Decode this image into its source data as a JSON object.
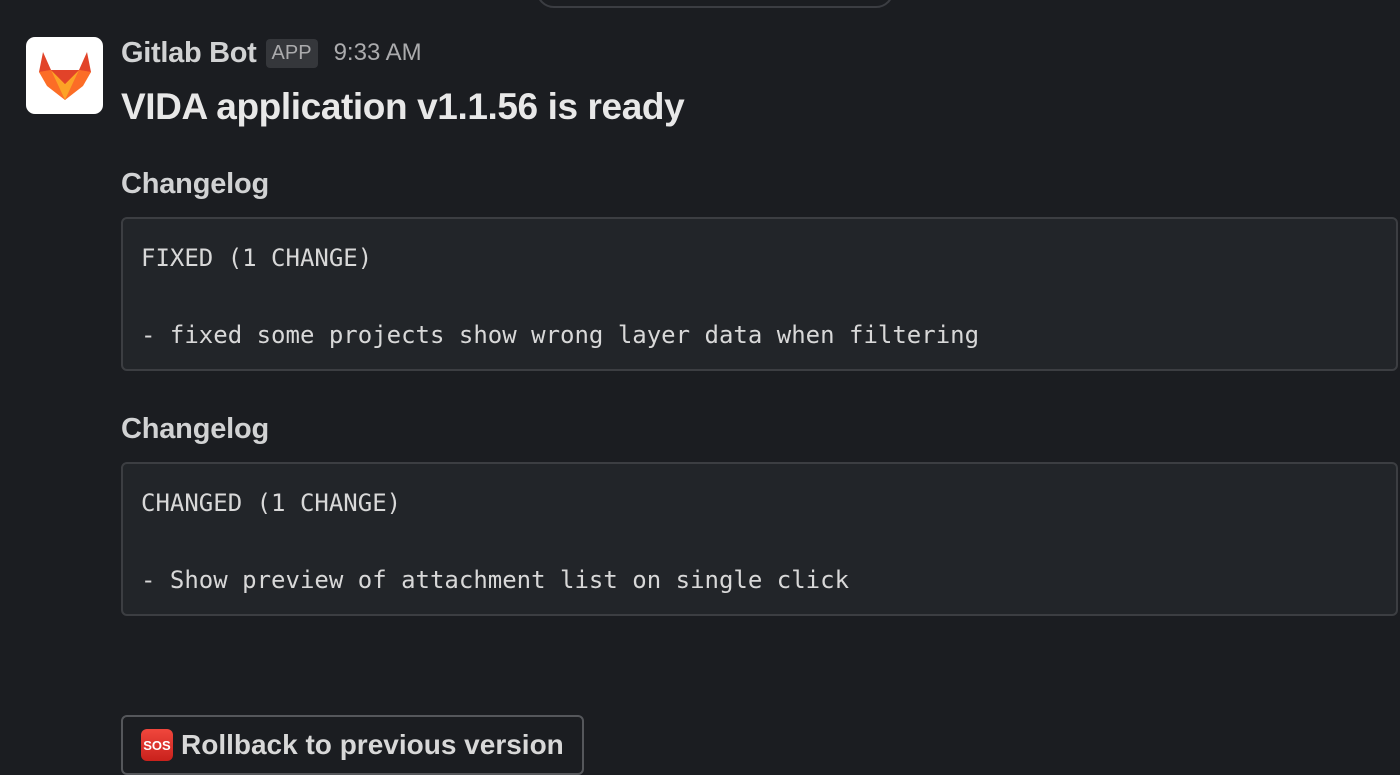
{
  "message": {
    "sender": "Gitlab Bot",
    "badge": "APP",
    "timestamp": "9:33 AM",
    "avatar_icon": "gitlab-fox-logo",
    "title": "VIDA application v1.1.56 is ready",
    "sections": [
      {
        "heading": "Changelog",
        "code_lines": [
          "FIXED (1 CHANGE)",
          "",
          "- fixed some projects show wrong layer data when filtering"
        ]
      },
      {
        "heading": "Changelog",
        "code_lines": [
          "CHANGED (1 CHANGE)",
          "",
          "- Show preview of attachment list on single click"
        ]
      }
    ],
    "action_button": {
      "icon": "sos-emoji",
      "icon_text": "SOS",
      "label": "Rollback to previous version"
    }
  },
  "colors": {
    "background": "#1b1d21",
    "code_background": "#222529",
    "sos_red": "#e0302a",
    "gitlab_orange": "#e24329"
  }
}
